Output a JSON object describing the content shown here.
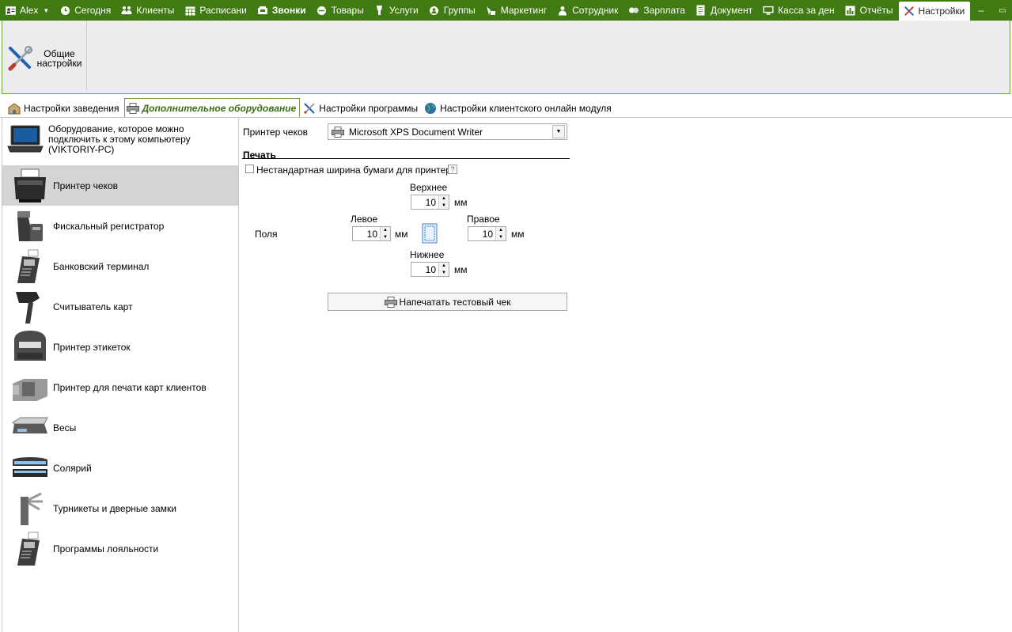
{
  "menu": {
    "user": "Alex",
    "items": [
      {
        "label": "Сегодня",
        "icon": "clock-icon"
      },
      {
        "label": "Клиенты",
        "icon": "people-icon"
      },
      {
        "label": "Расписани",
        "icon": "calendar-icon"
      },
      {
        "label": "Звонки",
        "icon": "phone-icon"
      },
      {
        "label": "Товары",
        "icon": "box-icon"
      },
      {
        "label": "Услуги",
        "icon": "service-icon"
      },
      {
        "label": "Группы",
        "icon": "group-icon"
      },
      {
        "label": "Маркетинг",
        "icon": "marketing-icon"
      },
      {
        "label": "Сотрудник",
        "icon": "employee-icon"
      },
      {
        "label": "Зарплата",
        "icon": "salary-icon"
      },
      {
        "label": "Документ",
        "icon": "document-icon"
      },
      {
        "label": "Касса за ден",
        "icon": "cash-icon"
      },
      {
        "label": "Отчёты",
        "icon": "report-icon"
      },
      {
        "label": "Настройки",
        "icon": "settings-icon"
      }
    ],
    "window_controls": [
      "–",
      "▭",
      "✕"
    ]
  },
  "ribbon": {
    "general_settings_label": "Общие настройки"
  },
  "tabs": [
    {
      "label": "Настройки заведения",
      "icon": "building-icon"
    },
    {
      "label": "Дополнительное оборудование",
      "icon": "printer-icon"
    },
    {
      "label": "Настройки программы",
      "icon": "tools-icon"
    },
    {
      "label": "Настройки клиентского онлайн модуля",
      "icon": "globe-icon"
    }
  ],
  "left_panel": {
    "header": "Оборудование, которое можно подключить к этому компьютеру (VIKTORIY-PC)",
    "items": [
      {
        "label": "Принтер чеков",
        "icon": "receipt-printer-icon"
      },
      {
        "label": "Фискальный регистратор",
        "icon": "fiscal-register-icon"
      },
      {
        "label": "Банковский терминал",
        "icon": "bank-terminal-icon"
      },
      {
        "label": "Считыватель карт",
        "icon": "card-reader-icon"
      },
      {
        "label": "Принтер этикеток",
        "icon": "label-printer-icon"
      },
      {
        "label": "Принтер для печати карт клиентов",
        "icon": "card-printer-icon"
      },
      {
        "label": "Весы",
        "icon": "scales-icon"
      },
      {
        "label": "Солярий",
        "icon": "solarium-icon"
      },
      {
        "label": "Турникеты и дверные замки",
        "icon": "turnstile-icon"
      },
      {
        "label": "Программы лояльности",
        "icon": "loyalty-terminal-icon"
      }
    ],
    "selected_index": 0
  },
  "settings": {
    "printer_label": "Принтер чеков",
    "printer_value": "Microsoft XPS Document Writer",
    "print_section": "Печать",
    "nonstandard_width_label": "Нестандартная ширина бумаги для принтера",
    "nonstandard_width_checked": false,
    "help_glyph": "?",
    "margins_label": "Поля",
    "top_label": "Верхнее",
    "top_value": "10",
    "left_label": "Левое",
    "left_value": "10",
    "right_label": "Правое",
    "right_value": "10",
    "bottom_label": "Нижнее",
    "bottom_value": "10",
    "unit": "мм",
    "test_print_button": "Напечатать тестовый чек"
  }
}
